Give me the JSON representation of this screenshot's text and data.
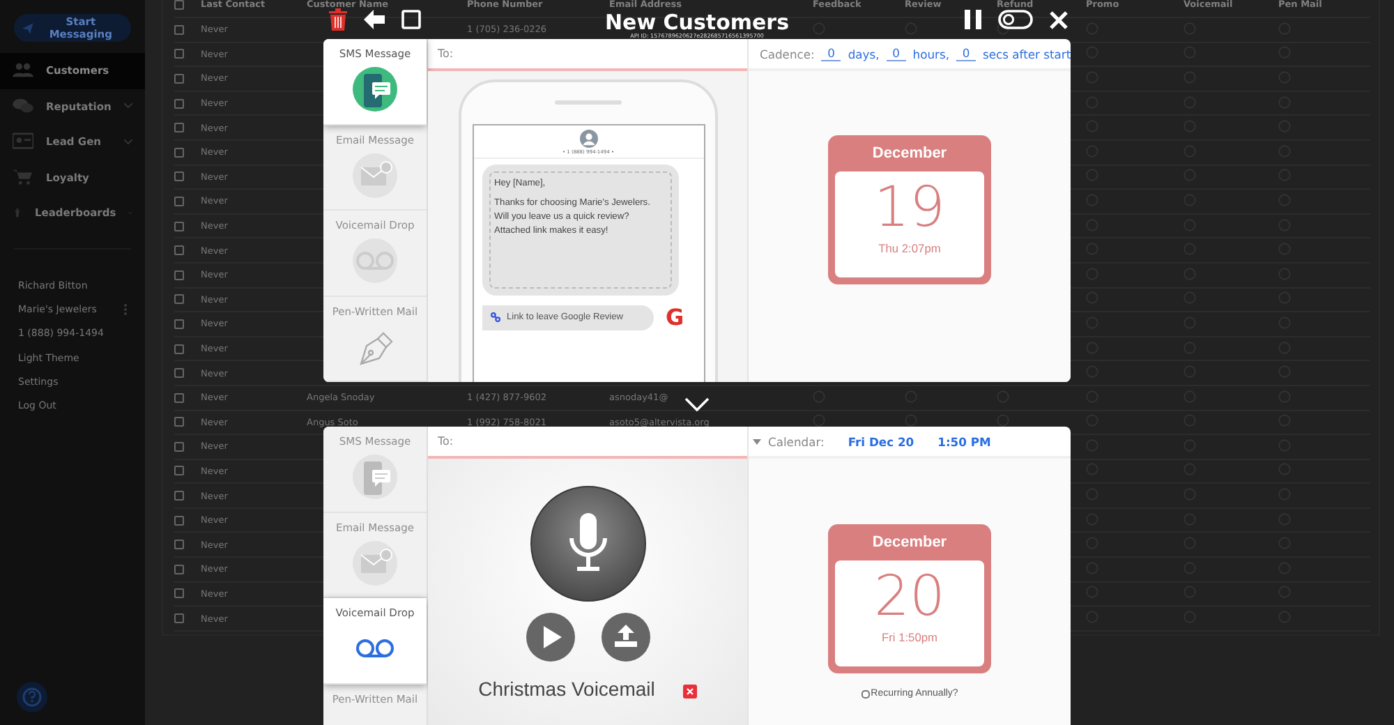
{
  "sidebar": {
    "cta": "Start Messaging",
    "items": [
      {
        "label": "Customers",
        "selected": true,
        "expandable": false
      },
      {
        "label": "Reputation",
        "selected": false,
        "expandable": true
      },
      {
        "label": "Lead Gen",
        "selected": false,
        "expandable": true
      },
      {
        "label": "Loyalty",
        "selected": false,
        "expandable": false
      },
      {
        "label": "Leaderboards",
        "selected": false,
        "expandable": true
      }
    ],
    "account": [
      {
        "label": "Richard Bitton",
        "menu": false
      },
      {
        "label": "Marie's Jewelers",
        "menu": true
      },
      {
        "label": "1 (888) 994-1494",
        "menu": false
      },
      {
        "label": "Light Theme",
        "menu": false
      },
      {
        "label": "Settings",
        "menu": false
      },
      {
        "label": "Log Out",
        "menu": false
      }
    ]
  },
  "table": {
    "select_all_checked": false,
    "columns": [
      "Last Contact",
      "Customer Name",
      "Phone Number",
      "Email Address",
      "Feedback",
      "Review",
      "Refund",
      "Promo",
      "Voicemail",
      "Pen Mail"
    ],
    "rows": [
      {
        "checked": false,
        "last_contact": "Never",
        "phone": "1 (705) 236-0226"
      },
      {
        "checked": false,
        "last_contact": "Never"
      },
      {
        "checked": false,
        "last_contact": "Never"
      },
      {
        "checked": false,
        "last_contact": "Never"
      },
      {
        "checked": false,
        "last_contact": "Never"
      },
      {
        "checked": false,
        "last_contact": "Never"
      },
      {
        "checked": false,
        "last_contact": "Never"
      },
      {
        "checked": false,
        "last_contact": "Never"
      },
      {
        "checked": false,
        "last_contact": "Never"
      },
      {
        "checked": false,
        "last_contact": "Never"
      },
      {
        "checked": false,
        "last_contact": "Never"
      },
      {
        "checked": false,
        "last_contact": "Never"
      },
      {
        "checked": false,
        "last_contact": "Never"
      },
      {
        "checked": false,
        "last_contact": "Never"
      },
      {
        "checked": false,
        "last_contact": "Never"
      },
      {
        "checked": false,
        "last_contact": "Never",
        "name": "Angela Snoday",
        "phone": "1 (427) 877-9602",
        "email": "asnoday41@"
      },
      {
        "checked": false,
        "last_contact": "Never",
        "name": "Angus Soto",
        "phone": "1 (992) 758-8021",
        "email": "asoto5@altervista.org"
      },
      {
        "checked": false,
        "last_contact": "Never"
      },
      {
        "checked": false,
        "last_contact": "Never"
      },
      {
        "checked": false,
        "last_contact": "Never"
      },
      {
        "checked": false,
        "last_contact": "Never"
      },
      {
        "checked": false,
        "last_contact": "Never"
      },
      {
        "checked": false,
        "last_contact": "Never"
      },
      {
        "checked": false,
        "last_contact": "Never"
      },
      {
        "checked": false,
        "last_contact": "Never"
      }
    ]
  },
  "modal": {
    "title": "New Customers",
    "api_id": "API ID: 1576789620627e282685716561395700",
    "steps": [
      {
        "tabs": [
          {
            "label": "SMS Message",
            "kind": "sms",
            "selected": true
          },
          {
            "label": "Email Message",
            "kind": "email",
            "selected": false
          },
          {
            "label": "Voicemail Drop",
            "kind": "voicemail",
            "selected": false
          },
          {
            "label": "Pen-Written Mail",
            "kind": "pen",
            "selected": false
          }
        ],
        "to_label": "To:",
        "content": {
          "kind": "sms",
          "sender": "• 1 (888) 994-1494 •",
          "message": [
            {
              "lines": [
                "Hey [Name],"
              ]
            },
            {
              "lines": [
                "Thanks for choosing Marie's Jewelers.",
                "Will you leave us a quick review?",
                "Attached link makes it easy!"
              ]
            }
          ],
          "link": "Link to leave Google Review",
          "link_badge": "G"
        },
        "schedule": {
          "kind": "cadence",
          "label": "Cadence:",
          "parts": [
            {
              "value": "0",
              "unit": "days,"
            },
            {
              "value": "0",
              "unit": "hours,"
            },
            {
              "value": "0",
              "unit": "secs after start"
            }
          ]
        },
        "calendar": {
          "month": "December",
          "day": "19",
          "caption": "Thu 2:07pm"
        }
      },
      {
        "tabs": [
          {
            "label": "SMS Message",
            "kind": "sms",
            "selected": false
          },
          {
            "label": "Email Message",
            "kind": "email",
            "selected": false
          },
          {
            "label": "Voicemail Drop",
            "kind": "voicemail",
            "selected": true
          },
          {
            "label": "Pen-Written Mail",
            "kind": "pen",
            "selected": false
          }
        ],
        "to_label": "To:",
        "content": {
          "kind": "voicemail",
          "recording": "Christmas Voicemail"
        },
        "schedule": {
          "kind": "calendar",
          "label": "Calendar:",
          "date": "Fri Dec 20",
          "time": "1:50 PM"
        },
        "calendar": {
          "month": "December",
          "day": "20",
          "caption": "Fri 1:50pm"
        },
        "recurring": {
          "label": "Recurring Annually?",
          "checked": false
        }
      }
    ]
  }
}
